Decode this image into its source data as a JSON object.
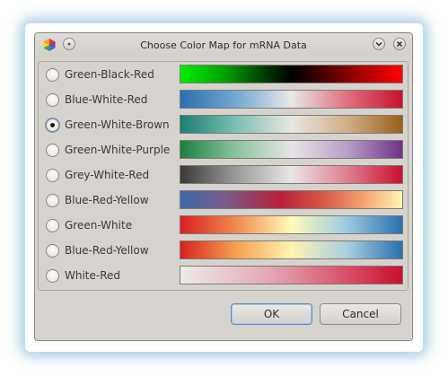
{
  "window": {
    "title": "Choose Color Map for mRNA Data",
    "accent": "#5b8dc6",
    "background": "#d6d2cd"
  },
  "titlebar_icons": {
    "app": "colorwheel-icon",
    "menu": "window-menu-icon",
    "minimize": "chevron-down-icon",
    "close": "close-icon"
  },
  "colormaps": [
    {
      "label": "Green-Black-Red",
      "selected": false,
      "gradient": "linear-gradient(to right, #00ee00 0%, #00a000 20%, #003000 40%, #000000 50%, #300000 60%, #a00000 80%, #ff0000 100%)"
    },
    {
      "label": "Blue-White-Red",
      "selected": false,
      "gradient": "linear-gradient(to right, #2a6faf 0%, #74a8d0 25%, #e8e8e8 50%, #e07080 75%, #c8102e 100%)"
    },
    {
      "label": "Green-White-Brown",
      "selected": true,
      "gradient": "linear-gradient(to right, #1a7f75 0%, #7cbfb2 25%, #e8e6e2 50%, #d0b08a 75%, #9a6018 100%)"
    },
    {
      "label": "Green-White-Purple",
      "selected": false,
      "gradient": "linear-gradient(to right, #1a8040 0%, #8cc3a0 25%, #e6e4e6 50%, #b8a0c8 75%, #70308a 100%)"
    },
    {
      "label": "Grey-White-Red",
      "selected": false,
      "gradient": "linear-gradient(to right, #3a3a3a 0%, #9a9a9a 25%, #e8e6e6 50%, #e08090 75%, #c8102e 100%)"
    },
    {
      "label": "Blue-Red-Yellow",
      "selected": false,
      "gradient": "linear-gradient(to right, #3a6aa8 0%, #7a5a8a 20%, #b8203a 45%, #d85a4a 65%, #f4a070 82%, #fff6b0 100%)"
    },
    {
      "label": "Green-White",
      "selected": false,
      "gradient": "linear-gradient(to right, #d82020 0%, #f08a50 25%, #fffbb8 50%, #9ccae0 75%, #2a70b0 100%)"
    },
    {
      "label": "Blue-Red-Yellow",
      "selected": false,
      "gradient": "linear-gradient(to right, #d82020 0%, #f8a050 25%, #fff4b0 50%, #a8d0e0 75%, #2a70b0 100%)"
    },
    {
      "label": "White-Red",
      "selected": false,
      "gradient": "linear-gradient(to right, #ebebeb 0%, #e4a8b4 40%, #d85068 75%, #c8102e 100%)"
    }
  ],
  "buttons": {
    "ok": "OK",
    "cancel": "Cancel"
  }
}
